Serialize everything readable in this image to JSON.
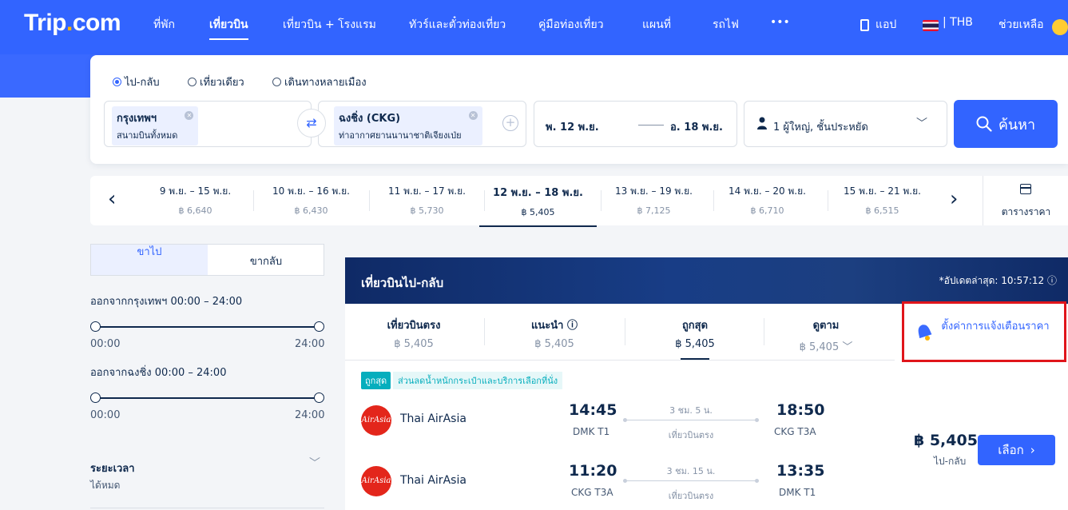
{
  "header": {
    "logo_main": "Trip",
    "logo_dot": ".",
    "logo_tld": "com",
    "nav": [
      {
        "label": "ที่พัก",
        "active": false
      },
      {
        "label": "เที่ยวบิน",
        "active": true
      },
      {
        "label": "เที่ยวบิน + โรงแรม",
        "active": false
      },
      {
        "label": "ทัวร์และตั๋วท่องเที่ยว",
        "active": false
      },
      {
        "label": "คู่มือท่องเที่ยว",
        "active": false
      },
      {
        "label": "แผนที่",
        "active": false
      },
      {
        "label": "รถไฟ",
        "active": false
      },
      {
        "label": "•••",
        "active": false
      }
    ],
    "app_label": "แอป",
    "currency_label": "| THB",
    "help_label": "ช่วยเหลือ"
  },
  "search": {
    "trip_types": [
      {
        "label": "ไป-กลับ",
        "selected": true
      },
      {
        "label": "เที่ยวเดียว",
        "selected": false
      },
      {
        "label": "เดินทางหลายเมือง",
        "selected": false
      }
    ],
    "origin": {
      "city": "กรุงเทพฯ",
      "airport": "สนามบินทั้งหมด"
    },
    "destination": {
      "city": "ฉงชิ่ง (CKG)",
      "airport": "ท่าอากาศยานนานาชาติเจียงเป่ย"
    },
    "depart_date": "พ. 12 พ.ย.",
    "return_date": "อ. 18 พ.ย.",
    "passengers": "1 ผู้ใหญ่, ชั้นประหยัด",
    "search_label": "ค้นหา"
  },
  "date_strip": {
    "dates": [
      {
        "range": "9 พ.ย. – 15 พ.ย.",
        "price": "฿ 6,640",
        "selected": false
      },
      {
        "range": "10 พ.ย. – 16 พ.ย.",
        "price": "฿ 6,430",
        "selected": false
      },
      {
        "range": "11 พ.ย. – 17 พ.ย.",
        "price": "฿ 5,730",
        "selected": false
      },
      {
        "range": "12 พ.ย. – 18 พ.ย.",
        "price": "฿ 5,405",
        "selected": true
      },
      {
        "range": "13 พ.ย. – 19 พ.ย.",
        "price": "฿ 7,125",
        "selected": false
      },
      {
        "range": "14 พ.ย. – 20 พ.ย.",
        "price": "฿ 6,710",
        "selected": false
      },
      {
        "range": "15 พ.ย. – 21 พ.ย.",
        "price": "฿ 6,515",
        "selected": false
      }
    ],
    "calendar_label": "ตารางราคา"
  },
  "filters": {
    "tab_outbound": "ขาไป",
    "tab_return": "ขากลับ",
    "depart_bkk": "ออกจากกรุงเทพฯ  00:00 – 24:00",
    "depart_ckg": "ออกจากฉงชิ่ง  00:00 – 24:00",
    "range_min": "00:00",
    "range_max": "24:00",
    "duration_title": "ระยะเวลา",
    "duration_value": "ได้หมด"
  },
  "results": {
    "title": "เที่ยวบินไป-กลับ",
    "updated": "*อัปเดตล่าสุด: 10:57:12",
    "sort_tabs": [
      {
        "title": "เที่ยวบินตรง",
        "price": "฿ 5,405",
        "selected": false
      },
      {
        "title": "แนะนำ ⓘ",
        "price": "฿ 5,405",
        "selected": false
      },
      {
        "title": "ถูกสุด",
        "price": "฿ 5,405",
        "selected": true
      },
      {
        "title": "ดูตาม",
        "price": "฿ 5,405 ﹀",
        "selected": false
      }
    ],
    "alert_label": "ตั้งค่าการแจ้งเตือนราคา",
    "tag_cheapest": "ถูกสุด",
    "tag_promo": "ส่วนลดน้ำหนักกระเป๋าและบริการเลือกที่นั่ง",
    "flight": {
      "legs": [
        {
          "airline": "Thai AirAsia",
          "logo_text": "AirAsia",
          "dep_time": "14:45",
          "dep_apt": "DMK T1",
          "duration": "3 ชม. 5 น.",
          "stop": "เที่ยวบินตรง",
          "arr_time": "18:50",
          "arr_apt": "CKG T3A"
        },
        {
          "airline": "Thai AirAsia",
          "logo_text": "AirAsia",
          "dep_time": "11:20",
          "dep_apt": "CKG T3A",
          "duration": "3 ชม. 15 น.",
          "stop": "เที่ยวบินตรง",
          "arr_time": "13:35",
          "arr_apt": "DMK T1"
        }
      ],
      "price": "฿ 5,405",
      "price_note": "ไป-กลับ",
      "select_label": "เลือก"
    }
  },
  "colors": {
    "brand": "#3264ff",
    "text": "#0f294d",
    "highlight": "#e0151b",
    "teal": "#06aebd"
  }
}
